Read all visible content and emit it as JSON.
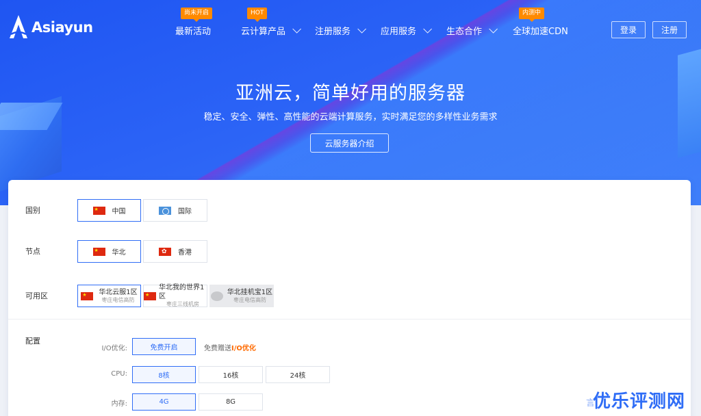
{
  "brand": {
    "name": "Asiayun"
  },
  "nav": {
    "items": [
      {
        "label": "最新活动",
        "badge": "尚未开启",
        "dropdown": false
      },
      {
        "label": "云计算产品",
        "badge": "HOT",
        "dropdown": true
      },
      {
        "label": "注册服务",
        "badge": "",
        "dropdown": true
      },
      {
        "label": "应用服务",
        "badge": "",
        "dropdown": true
      },
      {
        "label": "生态合作",
        "badge": "",
        "dropdown": true
      },
      {
        "label": "全球加速CDN",
        "badge": "内测中",
        "dropdown": false
      }
    ],
    "login": "登录",
    "register": "注册"
  },
  "hero": {
    "title": "亚洲云，简单好用的服务器",
    "subtitle": "稳定、安全、弹性、高性能的云端计算服务，实时满足您的多样性业务需求",
    "button": "云服务器介绍"
  },
  "config": {
    "country": {
      "label": "国别",
      "options": [
        {
          "label": "中国",
          "flag": "cn-flag-icon",
          "selected": true
        },
        {
          "label": "国际",
          "flag": "un-flag-icon",
          "selected": false
        }
      ]
    },
    "node": {
      "label": "节点",
      "options": [
        {
          "label": "华北",
          "flag": "cn-flag-icon",
          "selected": true
        },
        {
          "label": "香港",
          "flag": "hk-flag-icon",
          "selected": false
        }
      ]
    },
    "zone": {
      "label": "可用区",
      "options": [
        {
          "title": "华北云服1区",
          "sub": "枣庄电信高防",
          "selected": true,
          "disabled": false
        },
        {
          "title": "华北我的世界1区",
          "sub": "枣庄三线机房",
          "selected": false,
          "disabled": false
        },
        {
          "title": "华北挂机宝1区",
          "sub": "枣庄电信高防",
          "selected": false,
          "disabled": true
        }
      ]
    },
    "spec": {
      "label": "配置",
      "io_label": "I/O优化:",
      "io_button": "免费开启",
      "io_note_prefix": "免费赠送",
      "io_note_strong": "I/O优化",
      "cpu_label": "CPU:",
      "cpu_options": [
        "8核",
        "16核",
        "24核"
      ],
      "cpu_selected": 0,
      "mem_label": "内存:",
      "mem_options": [
        "4G",
        "8G"
      ],
      "mem_selected": 0
    }
  },
  "watermark": {
    "text": "优乐评测网",
    "partial": "言"
  },
  "colors": {
    "accent": "#2f6df6",
    "badge": "#ff8a00",
    "io_highlight": "#ff6a00"
  }
}
